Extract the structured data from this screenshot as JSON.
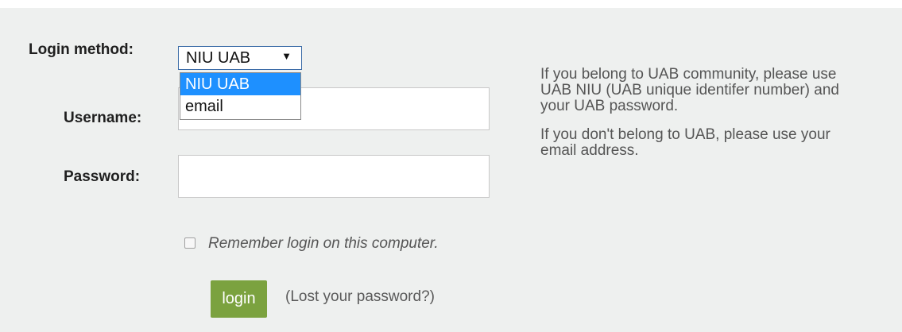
{
  "form": {
    "login_method_label": "Login method:",
    "login_method_value": "NIU UAB",
    "login_method_options": [
      "NIU UAB",
      "email"
    ],
    "username_label": "Username:",
    "username_value": "",
    "password_label": "Password:",
    "password_value": "",
    "remember_label": "Remember login on this computer.",
    "login_button": "login",
    "lost_password_link": "(Lost your password?)"
  },
  "help": {
    "uab_line1": "If you belong to UAB community, please use",
    "uab_line2": "UAB NIU (UAB unique identifer number) and",
    "uab_line3": "your UAB password.",
    "other_line1": "If you don't belong to UAB, please use your",
    "other_line2": "email address."
  },
  "colors": {
    "panel_bg": "#eef0ef",
    "login_button_bg": "#7ba23f",
    "selected_option_bg": "#1e90ff",
    "select_border": "#3d6da8"
  },
  "icons": {
    "select_arrow": "triangle-down-icon"
  }
}
